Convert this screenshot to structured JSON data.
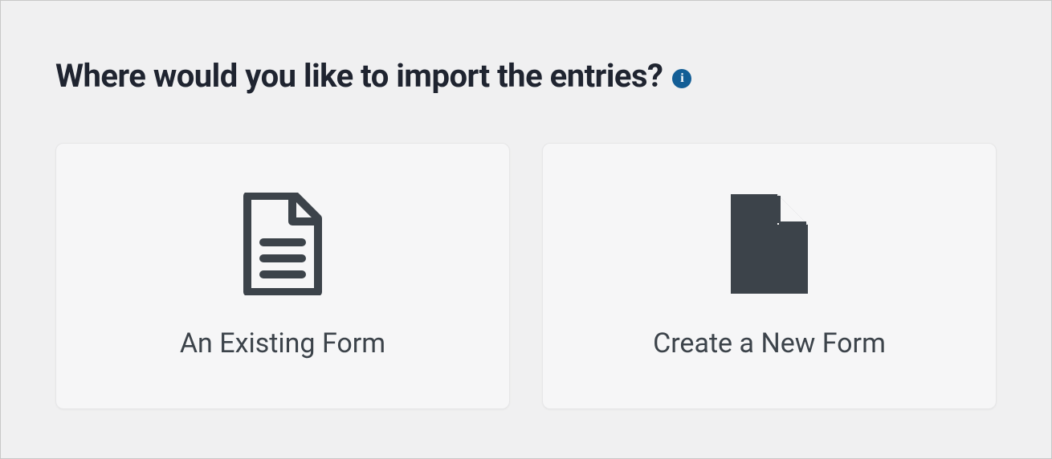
{
  "heading": "Where would you like to import the entries?",
  "info_tooltip_label": "i",
  "cards": {
    "existing": {
      "label": "An Existing Form",
      "icon": "document-lines-icon"
    },
    "new": {
      "label": "Create a New Form",
      "icon": "document-fold-icon"
    }
  },
  "colors": {
    "icon": "#3c434a",
    "info_bg": "#135e96"
  }
}
